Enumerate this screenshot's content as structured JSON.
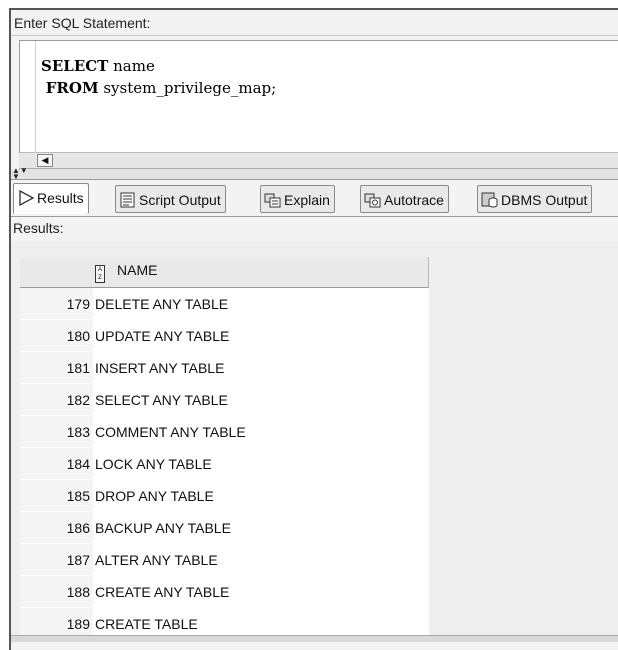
{
  "sql_panel": {
    "label": "Enter SQL Statement:",
    "line1_kw": "SELECT",
    "line1_rest": " name",
    "line2_kw": "FROM",
    "line2_rest": " system_privilege_map;"
  },
  "tabs": [
    {
      "label": "Results",
      "icon": "play-icon"
    },
    {
      "label": "Script Output",
      "icon": "script-icon"
    },
    {
      "label": "Explain",
      "icon": "explain-icon"
    },
    {
      "label": "Autotrace",
      "icon": "autotrace-icon"
    },
    {
      "label": "DBMS Output",
      "icon": "dbms-icon"
    }
  ],
  "results": {
    "label": "Results:",
    "column_header": "NAME",
    "rows": [
      {
        "num": "179",
        "name": "DELETE ANY TABLE"
      },
      {
        "num": "180",
        "name": "UPDATE ANY TABLE"
      },
      {
        "num": "181",
        "name": "INSERT ANY TABLE"
      },
      {
        "num": "182",
        "name": "SELECT ANY TABLE"
      },
      {
        "num": "183",
        "name": "COMMENT ANY TABLE"
      },
      {
        "num": "184",
        "name": "LOCK ANY TABLE"
      },
      {
        "num": "185",
        "name": "DROP ANY TABLE"
      },
      {
        "num": "186",
        "name": "BACKUP ANY TABLE"
      },
      {
        "num": "187",
        "name": "ALTER ANY TABLE"
      },
      {
        "num": "188",
        "name": "CREATE ANY TABLE"
      },
      {
        "num": "189",
        "name": "CREATE TABLE"
      }
    ]
  }
}
